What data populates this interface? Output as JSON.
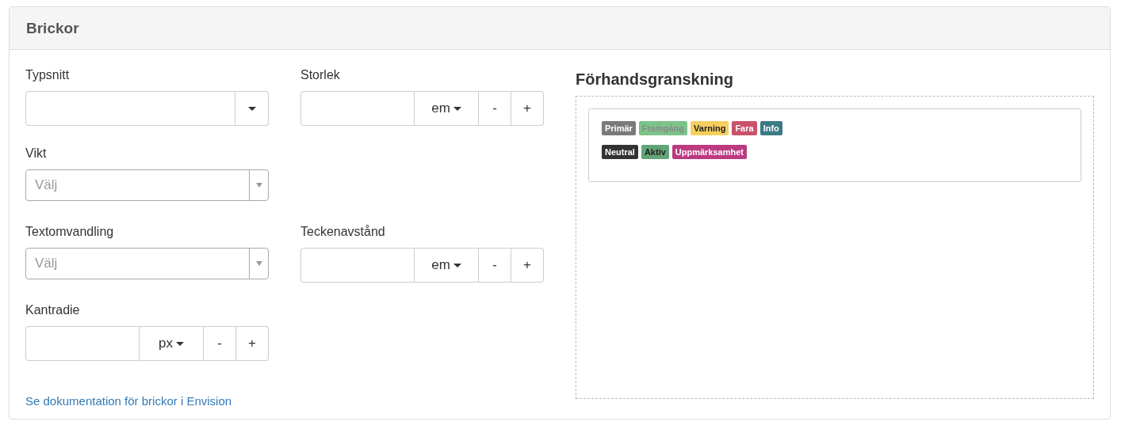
{
  "panel": {
    "title": "Brickor"
  },
  "form_rows": [
    [
      {
        "kind": "combo",
        "label": "Typsnitt"
      },
      {
        "kind": "unit",
        "label": "Storlek",
        "unit": "em",
        "minus": "-",
        "plus": "+"
      }
    ],
    [
      {
        "kind": "select",
        "label": "Vikt",
        "placeholder": "Välj"
      }
    ],
    [
      {
        "kind": "select",
        "label": "Textomvandling",
        "placeholder": "Välj"
      },
      {
        "kind": "unit",
        "label": "Teckenavstånd",
        "unit": "em",
        "minus": "-",
        "plus": "+"
      }
    ],
    [
      {
        "kind": "unit",
        "label": "Kantradie",
        "unit": "px",
        "minus": "-",
        "plus": "+"
      }
    ]
  ],
  "doc_link": "Se dokumentation för brickor i Envision",
  "preview": {
    "title": "Förhandsgranskning",
    "badge_rows": [
      [
        {
          "text": "Primär",
          "color": "#7b7b7b",
          "kind": "light"
        },
        {
          "text": "Framgång",
          "color": "#7cc38a",
          "kind": "muted"
        },
        {
          "text": "Varning",
          "color": "#f6cf5e",
          "kind": "dark"
        },
        {
          "text": "Fara",
          "color": "#c9526a",
          "kind": "light"
        },
        {
          "text": "Info",
          "color": "#3c7a86",
          "kind": "light"
        }
      ],
      [
        {
          "text": "Neutral",
          "color": "#333333",
          "kind": "light"
        },
        {
          "text": "Aktiv",
          "color": "#63a577",
          "kind": "dark"
        },
        {
          "text": "Uppmärksamhet",
          "color": "#bb3a80",
          "kind": "light"
        }
      ]
    ]
  }
}
